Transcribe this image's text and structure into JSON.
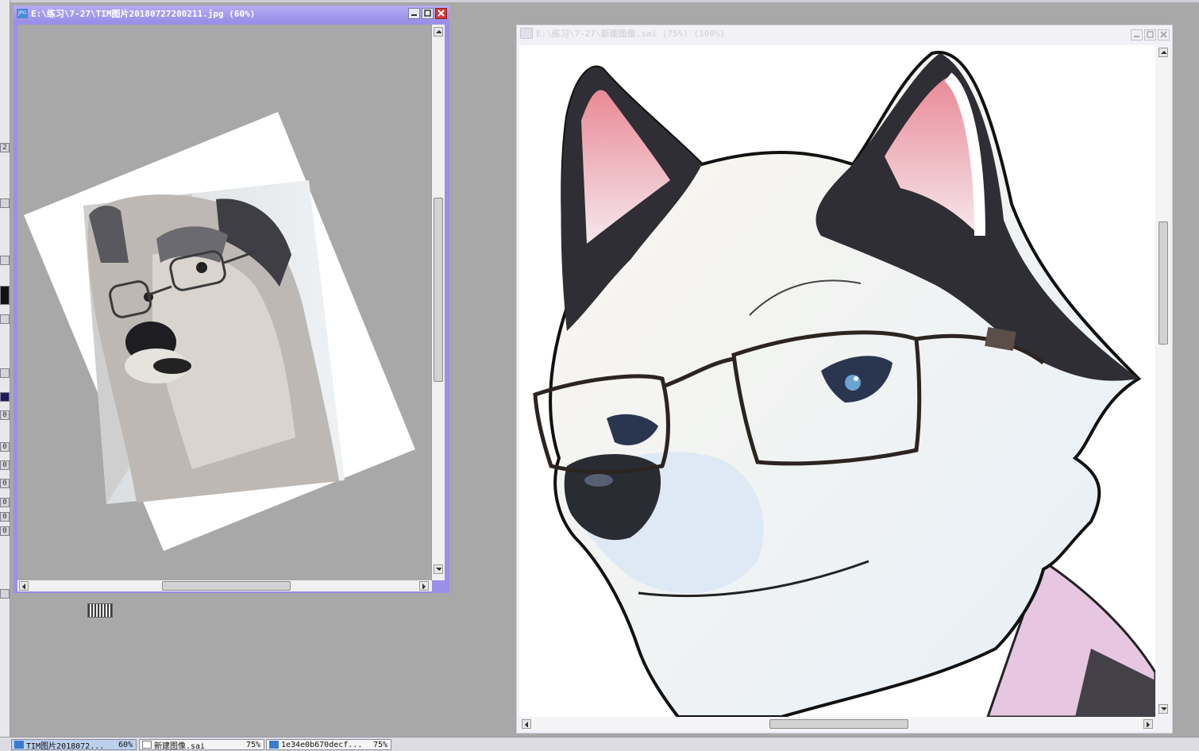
{
  "windows": {
    "photo": {
      "title": "E:\\练习\\7-27\\TIM图片20180727200211.jpg (60%)",
      "icon": "jpg-file-icon",
      "icon_label": "JPG",
      "active": true
    },
    "drawing": {
      "title": "E:\\练习\\7-27\\新建图像.sai (75%) (100%)",
      "icon": "sai-file-icon",
      "active": false
    }
  },
  "taskbar": {
    "tabs": [
      {
        "name": "TIM图片2018072...",
        "zoom": "60%",
        "icon": "jpg-file-icon",
        "active": true
      },
      {
        "name": "新建图像.sai",
        "zoom": "75%",
        "icon": "doc-file-icon",
        "active": false
      },
      {
        "name": "1e34e0b670decf...",
        "zoom": "75%",
        "icon": "jpg-file-icon",
        "active": false
      }
    ]
  },
  "toolstrip": {
    "labels": [
      "2",
      "0",
      "0",
      "0",
      "0",
      "0",
      "0",
      "0"
    ]
  },
  "colors": {
    "active_frame": "#9b8fe8",
    "inactive_frame": "#f2f2f6",
    "canvas_gray": "#a8a8a8",
    "close_red": "#d43a3a"
  },
  "canvas": {
    "photo_subject": "husky dog wearing glasses (photo, rotated)",
    "drawing_subject": "illustrated husky wearing glasses"
  }
}
